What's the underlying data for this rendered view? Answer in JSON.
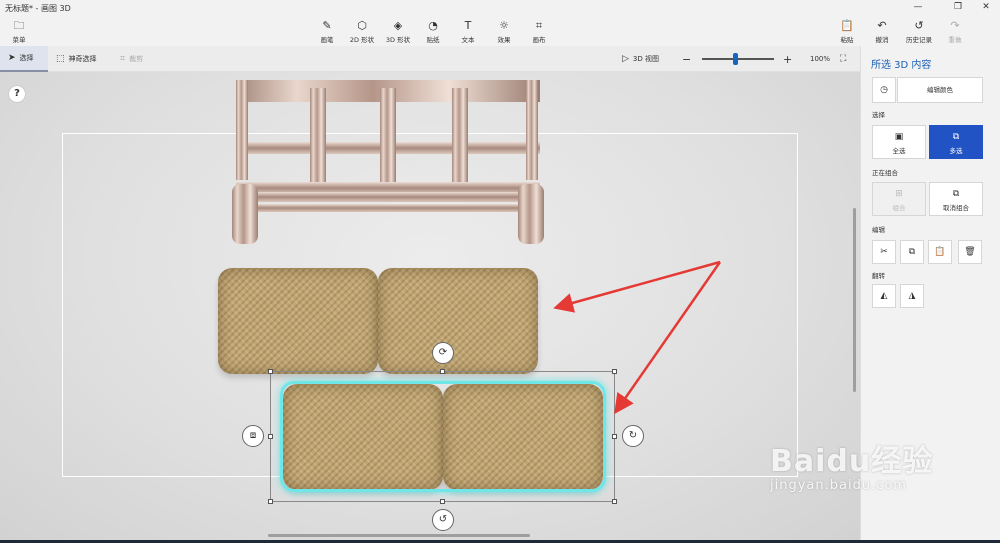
{
  "titlebar": {
    "title": "无标题* - 画图 3D",
    "minimize": "—",
    "maximize": "❐",
    "close": "✕"
  },
  "ribbon": {
    "menu": "菜单",
    "brushes": "画笔",
    "shapes2d": "2D 形状",
    "shapes3d": "3D 形状",
    "stickers": "贴纸",
    "text": "文本",
    "effects": "效果",
    "canvas": "画布",
    "paste": "粘贴",
    "undo": "撤消",
    "history": "历史记录",
    "redo": "重做"
  },
  "toolbar": {
    "select": "选择",
    "magic_select": "神奇选择",
    "crop": "裁剪",
    "view3d": "3D 视图",
    "zoom_minus": "−",
    "zoom_plus": "+",
    "zoom_level": "100%",
    "zoom_fraction": 0.47
  },
  "canvas": {
    "help": "?"
  },
  "panel": {
    "title": "所选 3D 内容",
    "edit_color": "编辑颜色",
    "select_section": "选择",
    "select_all": "全选",
    "multi_select": "多选",
    "grouping_section": "正在组合",
    "group": "组合",
    "ungroup": "取消组合",
    "edit_section": "编辑",
    "flip_section": "翻转"
  },
  "colors": {
    "accent": "#2253c4",
    "selection": "#6fe6e8",
    "arrow": "#e53935",
    "cushion": "#c1a672"
  },
  "watermark": {
    "brand": "Baidu经验",
    "url": "jingyan.baidu.com"
  }
}
